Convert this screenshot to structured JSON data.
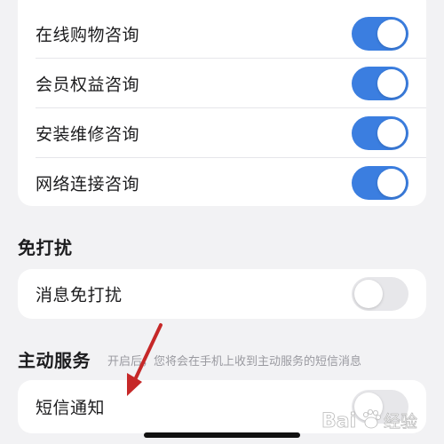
{
  "consult_group": {
    "items": [
      {
        "label": "在线购物咨询",
        "enabled": true
      },
      {
        "label": "会员权益咨询",
        "enabled": true
      },
      {
        "label": "安装维修咨询",
        "enabled": true
      },
      {
        "label": "网络连接咨询",
        "enabled": true
      }
    ]
  },
  "dnd_section": {
    "title": "免打扰",
    "items": [
      {
        "label": "消息免打扰",
        "enabled": false
      }
    ]
  },
  "active_service_section": {
    "title": "主动服务",
    "description": "开启后，您将会在手机上收到主动服务的短信消息",
    "items": [
      {
        "label": "短信通知",
        "enabled": false
      }
    ]
  },
  "colors": {
    "toggle_on": "#3b7ee0",
    "toggle_off": "#e7e7ea",
    "annotation_arrow": "#c62828"
  },
  "watermark": {
    "brand": "Bai",
    "brand_suffix": "经验"
  }
}
